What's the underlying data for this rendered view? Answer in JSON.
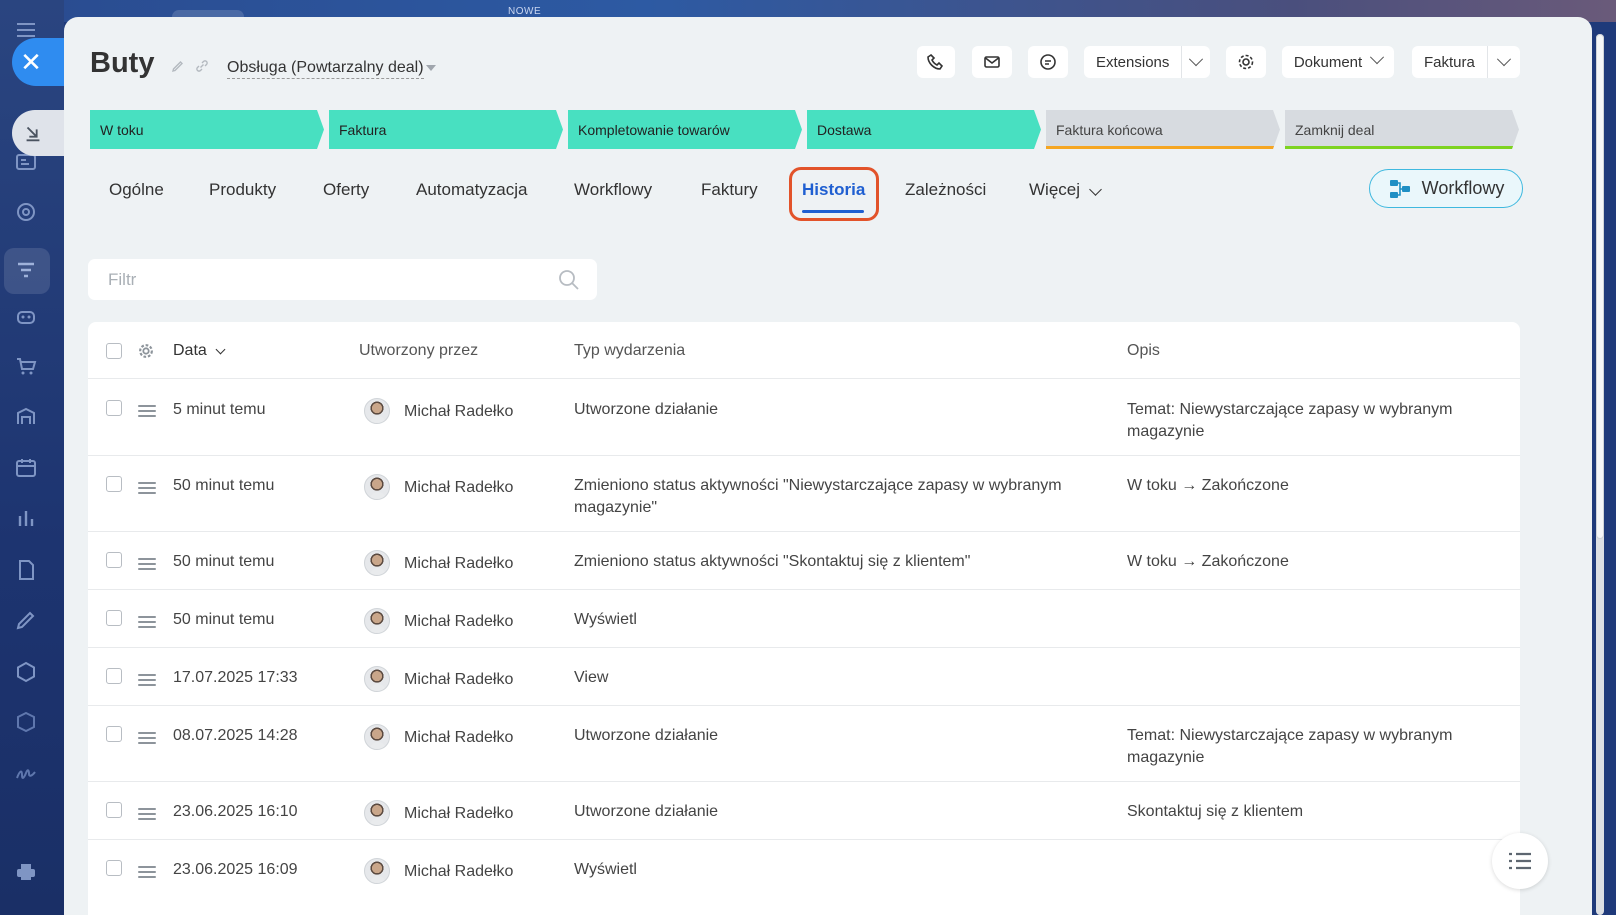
{
  "background": {
    "top_label": "NOWE"
  },
  "header": {
    "title": "Buty",
    "pipeline": "Obsługa (Powtarzalny deal)",
    "buttons": {
      "extensions": "Extensions",
      "dokument": "Dokument",
      "faktura": "Faktura"
    }
  },
  "stages": [
    {
      "label": "W toku",
      "state": "done"
    },
    {
      "label": "Faktura",
      "state": "done"
    },
    {
      "label": "Kompletowanie towarów",
      "state": "done"
    },
    {
      "label": "Dostawa",
      "state": "done"
    },
    {
      "label": "Faktura końcowa",
      "state": "todo",
      "accent": "#f5a623"
    },
    {
      "label": "Zamknij deal",
      "state": "todo",
      "accent": "#7ed321"
    }
  ],
  "tabs": [
    {
      "label": "Ogólne"
    },
    {
      "label": "Produkty"
    },
    {
      "label": "Oferty"
    },
    {
      "label": "Automatyzacja"
    },
    {
      "label": "Workflowy"
    },
    {
      "label": "Faktury"
    },
    {
      "label": "Historia",
      "active": true
    },
    {
      "label": "Zależności"
    },
    {
      "label": "Więcej"
    }
  ],
  "workflow_button": "Workflowy",
  "filter": {
    "placeholder": "Filtr"
  },
  "table": {
    "columns": {
      "date": "Data",
      "created_by": "Utworzony przez",
      "event_type": "Typ wydarzenia",
      "description": "Opis"
    },
    "rows": [
      {
        "date": "5 minut temu",
        "user": "Michał Radełko",
        "event_line1": "Utworzone działanie",
        "event_line2": "",
        "desc_line1": "Temat: Niewystarczające zapasy w wybranym",
        "desc_line2": "magazynie"
      },
      {
        "date": "50 minut temu",
        "user": "Michał Radełko",
        "event_line1": "Zmieniono status aktywności \"Niewystarczające zapasy w wybranym",
        "event_line2": "magazynie\"",
        "desc_line1": "W toku → Zakończone",
        "desc_line2": ""
      },
      {
        "date": "50 minut temu",
        "user": "Michał Radełko",
        "event_line1": "Zmieniono status aktywności \"Skontaktuj się z klientem\"",
        "event_line2": "",
        "desc_line1": "W toku → Zakończone",
        "desc_line2": ""
      },
      {
        "date": "50 minut temu",
        "user": "Michał Radełko",
        "event_line1": "Wyświetl",
        "event_line2": "",
        "desc_line1": "",
        "desc_line2": ""
      },
      {
        "date": "17.07.2025 17:33",
        "user": "Michał Radełko",
        "event_line1": "View",
        "event_line2": "",
        "desc_line1": "",
        "desc_line2": ""
      },
      {
        "date": "08.07.2025 14:28",
        "user": "Michał Radełko",
        "event_line1": "Utworzone działanie",
        "event_line2": "",
        "desc_line1": "Temat: Niewystarczające zapasy w wybranym",
        "desc_line2": "magazynie"
      },
      {
        "date": "23.06.2025 16:10",
        "user": "Michał Radełko",
        "event_line1": "Utworzone działanie",
        "event_line2": "",
        "desc_line1": "Skontaktuj się z klientem",
        "desc_line2": ""
      },
      {
        "date": "23.06.2025 16:09",
        "user": "Michał Radełko",
        "event_line1": "Wyświetl",
        "event_line2": "",
        "desc_line1": "",
        "desc_line2": ""
      }
    ]
  },
  "colors": {
    "stage_done": "#48e0c1",
    "stage_todo": "#d7dbe0",
    "active_tab": "#1f5fd1",
    "highlight": "#e2532a"
  }
}
